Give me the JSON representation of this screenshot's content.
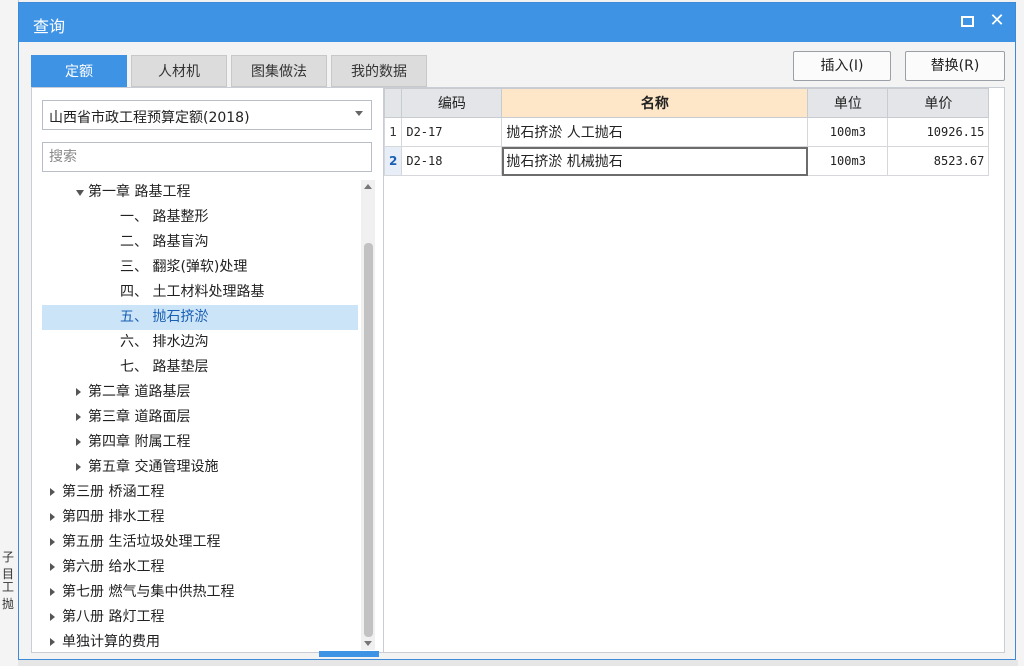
{
  "dialog": {
    "title": "查询",
    "maximize_icon": "maximize-icon",
    "close_label": "✕"
  },
  "tabs": [
    {
      "label": "定额",
      "active": true
    },
    {
      "label": "人材机",
      "active": false
    },
    {
      "label": "图集做法",
      "active": false
    },
    {
      "label": "我的数据",
      "active": false
    }
  ],
  "actions": {
    "insert_label": "插入(I)",
    "replace_label": "替换(R)"
  },
  "left": {
    "dropdown_value": "山西省市政工程预算定额(2018)",
    "search_placeholder": "搜索",
    "tree": [
      {
        "label": "第一章 路基工程",
        "level": 1,
        "state": "expanded"
      },
      {
        "label": "一、 路基整形",
        "level": 2,
        "state": "leaf"
      },
      {
        "label": "二、 路基盲沟",
        "level": 2,
        "state": "leaf"
      },
      {
        "label": "三、 翻浆(弹软)处理",
        "level": 2,
        "state": "leaf"
      },
      {
        "label": "四、 土工材料处理路基",
        "level": 2,
        "state": "leaf"
      },
      {
        "label": "五、 抛石挤淤",
        "level": 2,
        "state": "leaf",
        "selected": true
      },
      {
        "label": "六、 排水边沟",
        "level": 2,
        "state": "leaf"
      },
      {
        "label": "七、 路基垫层",
        "level": 2,
        "state": "leaf"
      },
      {
        "label": "第二章 道路基层",
        "level": 1,
        "state": "collapsed"
      },
      {
        "label": "第三章 道路面层",
        "level": 1,
        "state": "collapsed"
      },
      {
        "label": "第四章 附属工程",
        "level": 1,
        "state": "collapsed"
      },
      {
        "label": "第五章 交通管理设施",
        "level": 1,
        "state": "collapsed"
      },
      {
        "label": "第三册 桥涵工程",
        "level": 0,
        "state": "collapsed"
      },
      {
        "label": "第四册 排水工程",
        "level": 0,
        "state": "collapsed"
      },
      {
        "label": "第五册 生活垃圾处理工程",
        "level": 0,
        "state": "collapsed"
      },
      {
        "label": "第六册 给水工程",
        "level": 0,
        "state": "collapsed"
      },
      {
        "label": "第七册 燃气与集中供热工程",
        "level": 0,
        "state": "collapsed"
      },
      {
        "label": "第八册 路灯工程",
        "level": 0,
        "state": "collapsed"
      },
      {
        "label": "单独计算的费用",
        "level": 0,
        "state": "collapsed"
      }
    ]
  },
  "grid": {
    "headers": [
      "编码",
      "名称",
      "单位",
      "单价"
    ],
    "rows": [
      {
        "num": "1",
        "code": "D2-17",
        "name": "抛石挤淤 人工抛石",
        "unit": "100m3",
        "price": "10926.15"
      },
      {
        "num": "2",
        "code": "D2-18",
        "name": "抛石挤淤 机械抛石",
        "unit": "100m3",
        "price": "8523.67",
        "current": true
      }
    ]
  },
  "background": {
    "left_fragments": [
      "子目",
      "工",
      "抛"
    ]
  },
  "colors": {
    "accent": "#3f93e5",
    "selected_row": "#cce4f7",
    "name_header": "#fde7c8"
  }
}
